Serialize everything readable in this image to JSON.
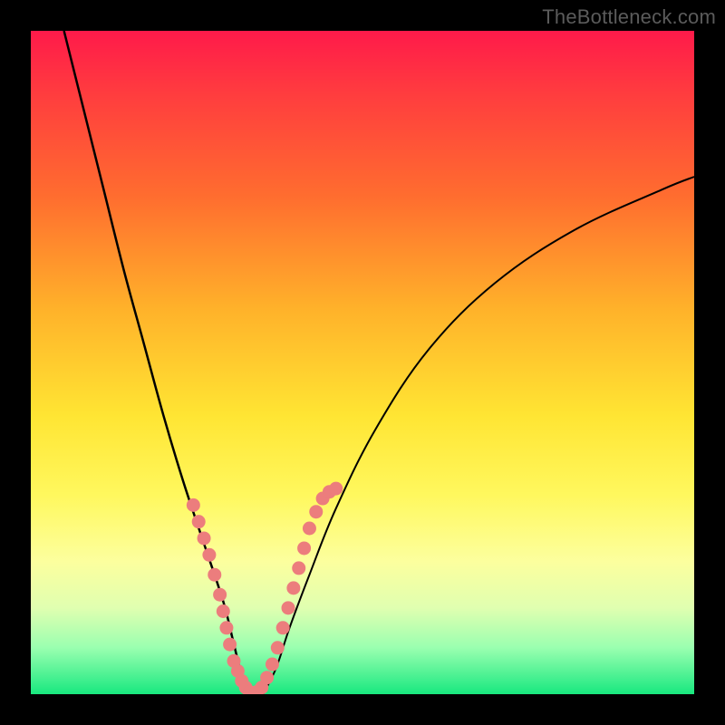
{
  "watermark": "TheBottleneck.com",
  "chart_data": {
    "type": "line",
    "title": "",
    "xlabel": "",
    "ylabel": "",
    "xlim": [
      0,
      100
    ],
    "ylim": [
      0,
      100
    ],
    "grid": false,
    "legend": false,
    "series": [
      {
        "name": "left-curve",
        "color": "#000000",
        "x": [
          5,
          8,
          11,
          14,
          17,
          20,
          23,
          26,
          29,
          30.5,
          32,
          33
        ],
        "y": [
          100,
          88,
          76,
          64,
          53,
          42,
          32,
          23,
          14,
          8,
          2,
          0
        ]
      },
      {
        "name": "right-curve",
        "color": "#000000",
        "x": [
          35,
          37,
          39,
          42,
          46,
          52,
          60,
          70,
          82,
          95,
          100
        ],
        "y": [
          0,
          4,
          10,
          18,
          28,
          40,
          52,
          62,
          70,
          76,
          78
        ]
      },
      {
        "name": "highlight-dots-left",
        "color": "#ec7d7d",
        "x": [
          24.5,
          25.3,
          26.1,
          26.9,
          27.7,
          28.5,
          29.0,
          29.5,
          30.0,
          30.6,
          31.2,
          31.8,
          32.4,
          33.0
        ],
        "y": [
          28.5,
          26.0,
          23.5,
          21.0,
          18.0,
          15.0,
          12.5,
          10.0,
          7.5,
          5.0,
          3.5,
          2.0,
          1.0,
          0.3
        ]
      },
      {
        "name": "highlight-dots-right",
        "color": "#ec7d7d",
        "x": [
          34.0,
          34.8,
          35.6,
          36.4,
          37.2,
          38.0,
          38.8,
          39.6,
          40.4,
          41.2,
          42.0,
          43.0,
          44.0,
          45.0,
          46.0
        ],
        "y": [
          0.3,
          1.0,
          2.5,
          4.5,
          7.0,
          10.0,
          13.0,
          16.0,
          19.0,
          22.0,
          25.0,
          27.5,
          29.5,
          30.5,
          31.0
        ]
      }
    ]
  },
  "colors": {
    "frame": "#000000",
    "curve": "#000000",
    "dot": "#ec7d7d",
    "watermark": "#5b5b5b"
  }
}
